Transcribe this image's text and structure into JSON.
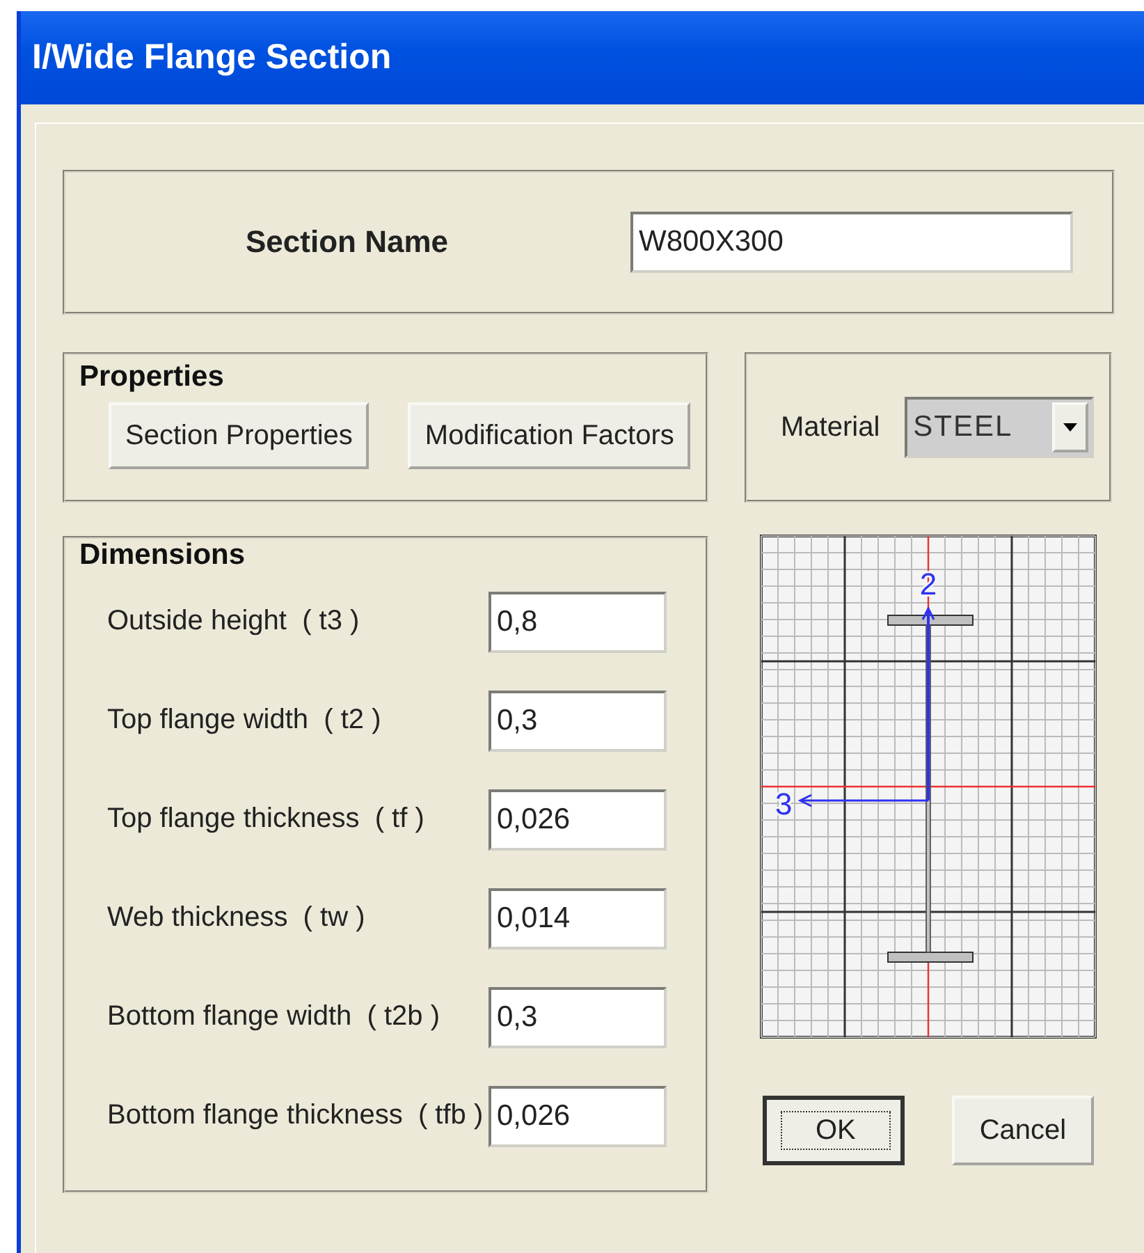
{
  "window": {
    "title": "I/Wide Flange Section"
  },
  "section_name": {
    "label": "Section Name",
    "value": "W800X300"
  },
  "properties": {
    "title": "Properties",
    "buttons": [
      "Section Properties",
      "Modification Factors"
    ]
  },
  "material": {
    "label": "Material",
    "value": "STEEL",
    "disabled": true
  },
  "dimensions": {
    "title": "Dimensions",
    "rows": [
      {
        "label": "Outside height  ( t3 )",
        "value": "0,8"
      },
      {
        "label": "Top flange width  ( t2 )",
        "value": "0,3"
      },
      {
        "label": "Top flange thickness  ( tf )",
        "value": "0,026"
      },
      {
        "label": "Web thickness  ( tw )",
        "value": "0,014"
      },
      {
        "label": "Bottom flange width  ( t2b )",
        "value": "0,3"
      },
      {
        "label": "Bottom flange thickness  ( tfb )",
        "value": "0,026"
      }
    ]
  },
  "preview": {
    "axis_labels": [
      "2",
      "3"
    ]
  },
  "buttons": [
    {
      "label": "OK",
      "default": true
    },
    {
      "label": "Cancel",
      "default": false
    }
  ]
}
